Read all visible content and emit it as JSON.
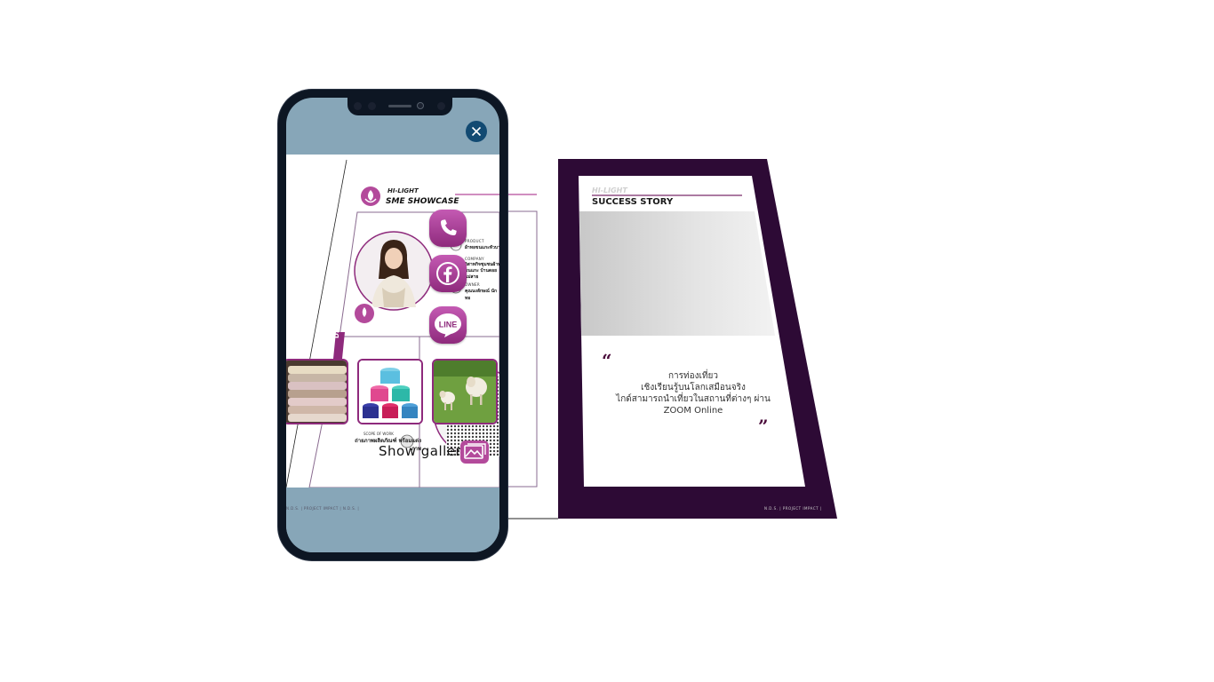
{
  "success_story": {
    "kicker": "HI-LIGHT",
    "title": "SUCCESS STORY",
    "quote_lines": [
      "การท่องเที่ยว",
      "เชิงเรียนรู้บนโลกเสมือนจริง",
      "ไกด์สามารถนำเที่ยวในสถานที่ต่างๆ ผ่าน",
      "ZOOM Online"
    ],
    "quote_open": "“",
    "quote_close": "”",
    "footer": "N.D.S. | PROJECT IMPACT |"
  },
  "sme_showcase": {
    "kicker": "HI-LIGHT",
    "title": "SME SHOWCASE",
    "tab_label": "DSP",
    "product_label": "PRODUCT",
    "product_value": "ผ้าทอขนแกะหัวบาน",
    "company_label": "COMPANY",
    "company_value": "วิสาหกิจชุมชนผ้าทอขนแกะ บ้านดอย แม่สาย",
    "owner_label": "OWNER",
    "owner_value": "คุณนงลักษณ์ นักทอ",
    "scope_label": "SCOPE OF WORK",
    "scope_value": "ถ่ายภาพผลิตภัณฑ์ พร้อมแต่งภาพ",
    "footer": "N.D.S. | PROJECT IMPACT | N.D.S. |"
  },
  "actions": {
    "call_icon": "phone-icon",
    "facebook_icon": "facebook-icon",
    "line_label": "LINE",
    "close_icon": "close-icon"
  },
  "gallery": {
    "thumbs": [
      "folded-scarves",
      "yarn-spools",
      "sheep-in-field"
    ],
    "show_label": "Show gallery",
    "icon": "gallery-icon"
  },
  "colors": {
    "accent": "#8e2a7c",
    "dark_purple": "#2d0a35",
    "phone_sky": "#87a6b8",
    "close_button": "#124a72"
  }
}
